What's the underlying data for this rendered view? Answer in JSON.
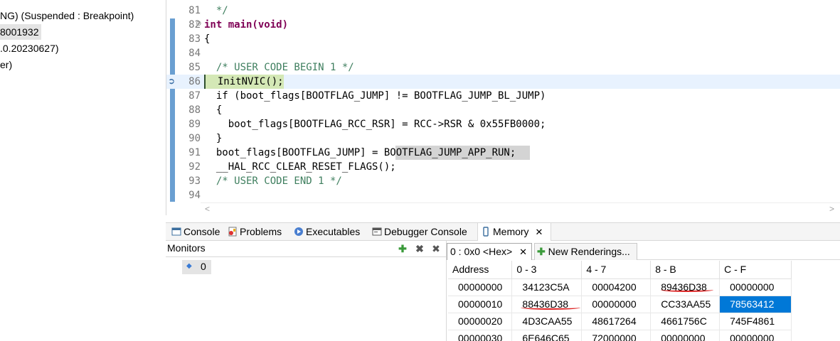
{
  "debug": {
    "lines": [
      "NG) (Suspended : Breakpoint)",
      "8001932",
      ".0.20230627)",
      "er)"
    ]
  },
  "editor": {
    "top_partial": "*",
    "lines": [
      {
        "num": "81",
        "text": "  */"
      },
      {
        "num": "82",
        "text": "int main(void)"
      },
      {
        "num": "83",
        "text": "{"
      },
      {
        "num": "84",
        "text": ""
      },
      {
        "num": "85",
        "text": "  /* USER CODE BEGIN 1 */"
      },
      {
        "num": "86",
        "text": "  InitNVIC();"
      },
      {
        "num": "87",
        "text": "  if (boot_flags[BOOTFLAG_JUMP] != BOOTFLAG_JUMP_BL_JUMP)"
      },
      {
        "num": "88",
        "text": "  {"
      },
      {
        "num": "89",
        "text": "    boot_flags[BOOTFLAG_RCC_RSR] = RCC->RSR & 0x55FB0000;"
      },
      {
        "num": "90",
        "text": "  }"
      },
      {
        "num": "91",
        "text": "  boot_flags[BOOTFLAG_JUMP] = BOOTFLAG_JUMP_APP_RUN;"
      },
      {
        "num": "92",
        "text": "  __HAL_RCC_CLEAR_RESET_FLAGS();"
      },
      {
        "num": "93",
        "text": "  /* USER CODE END 1 */"
      },
      {
        "num": "94",
        "text": ""
      }
    ],
    "scroll_left": "<",
    "scroll_right": ">"
  },
  "views": {
    "tabs": [
      {
        "label": "Console",
        "icon": "console-icon"
      },
      {
        "label": "Problems",
        "icon": "problems-icon"
      },
      {
        "label": "Executables",
        "icon": "executables-icon"
      },
      {
        "label": "Debugger Console",
        "icon": "debugger-console-icon"
      },
      {
        "label": "Memory",
        "icon": "memory-icon",
        "active": true
      }
    ],
    "close": "✕"
  },
  "monitors": {
    "title": "Monitors",
    "item": "0",
    "tools": [
      "add-icon",
      "remove-icon",
      "remove-all-icon"
    ]
  },
  "renderings": {
    "tab1": "0 : 0x0 <Hex>",
    "tab1_close": "✕",
    "tab2": "New Renderings...",
    "headers": [
      "Address",
      "0 - 3",
      "4 - 7",
      "8 - B",
      "C - F"
    ],
    "rows": [
      [
        "00000000",
        "34123C5A",
        "00004200",
        "89436D38",
        "00000000"
      ],
      [
        "00000010",
        "88436D38",
        "00000000",
        "CC33AA55",
        "78563412"
      ],
      [
        "00000020",
        "4D3CAA55",
        "48617264",
        "4661756C",
        "745F4861"
      ],
      [
        "00000030",
        "6E646C65",
        "72000000",
        "00000000",
        "00000000"
      ]
    ],
    "selected_cell": "78563412"
  }
}
